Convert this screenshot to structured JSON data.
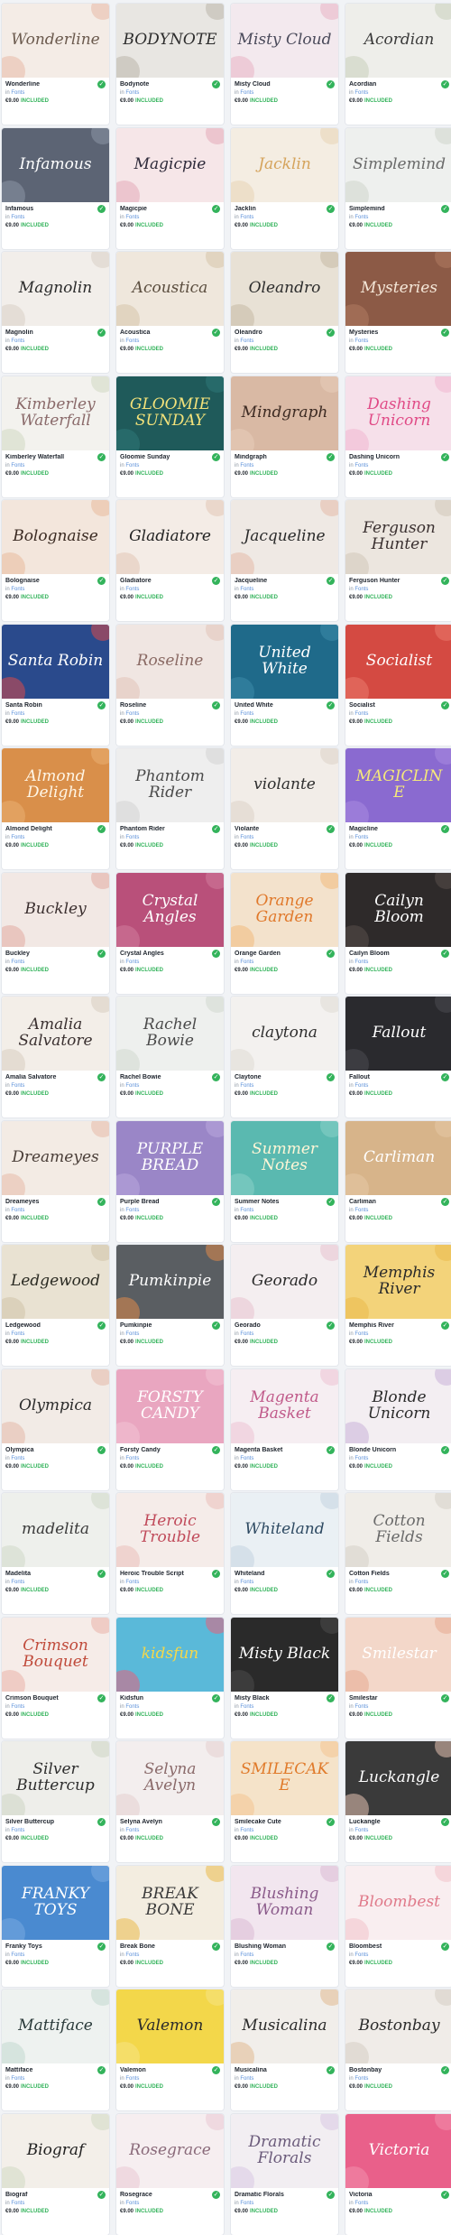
{
  "labels": {
    "by": "in",
    "category": "Fonts",
    "included": "INCLUDED"
  },
  "colors": {
    "check": "#33b35b",
    "category": "#5a8fd9"
  },
  "items": [
    {
      "name": "Wonderline",
      "title": "Wonderline",
      "price": "€9.00",
      "bg": "#f4ece6",
      "fg": "#6b5a4e",
      "acc": "#e8b9a6"
    },
    {
      "name": "Bodynote",
      "title": "BODYNOTE",
      "price": "€9.00",
      "bg": "#e8e6e2",
      "fg": "#2c2c2c",
      "acc": "#b9b4aa"
    },
    {
      "name": "Misty Cloud",
      "title": "Misty Cloud",
      "price": "€9.00",
      "bg": "#f3e9ee",
      "fg": "#4a4a5a",
      "acc": "#e7b3c5"
    },
    {
      "name": "Acordian",
      "title": "Acordian",
      "price": "€9.00",
      "bg": "#eeeeea",
      "fg": "#3b3b3b",
      "acc": "#c9d0b9"
    },
    {
      "name": "Infamous",
      "title": "Infamous",
      "price": "€9.00",
      "bg": "#5c6474",
      "fg": "#ffffff",
      "acc": "#8d95a5"
    },
    {
      "name": "Magicpie",
      "title": "Magicpie",
      "price": "€9.00",
      "bg": "#f6e6e8",
      "fg": "#2e2a3a",
      "acc": "#e3a9b8"
    },
    {
      "name": "Jacklin",
      "title": "Jacklin",
      "price": "€9.00",
      "bg": "#f4ede2",
      "fg": "#d5a35b",
      "acc": "#e7d3b5"
    },
    {
      "name": "Simplemind",
      "title": "Simplemind",
      "price": "€9.00",
      "bg": "#eef0ee",
      "fg": "#6a6a6a",
      "acc": "#cfd6cc"
    },
    {
      "name": "Magnolin",
      "title": "Magnolin",
      "price": "€9.00",
      "bg": "#f2eeea",
      "fg": "#2a2a2a",
      "acc": "#d8cfc4"
    },
    {
      "name": "Acoustica",
      "title": "Acoustica",
      "price": "€9.00",
      "bg": "#efe7dc",
      "fg": "#5a4d3e",
      "acc": "#d6c4aa"
    },
    {
      "name": "Oleandro",
      "title": "Oleandro",
      "price": "€9.00",
      "bg": "#e8e1d5",
      "fg": "#2c2c2c",
      "acc": "#c5b9a4"
    },
    {
      "name": "Mysteries",
      "title": "Mysteries",
      "price": "€9.00",
      "bg": "#8c5a46",
      "fg": "#f5e7d8",
      "acc": "#b07c63"
    },
    {
      "name": "Kimberley Waterfall",
      "title": "Kimberley Waterfall",
      "price": "€9.00",
      "bg": "#f3f2ee",
      "fg": "#8a6a6a",
      "acc": "#cfd9c3"
    },
    {
      "name": "Gloomie Sunday",
      "title": "GLOOMIE SUNDAY",
      "price": "€9.00",
      "bg": "#1f5a5a",
      "fg": "#f3e27a",
      "acc": "#2e7878"
    },
    {
      "name": "Mindgraph",
      "title": "Mindgraph",
      "price": "€9.00",
      "bg": "#d9b9a4",
      "fg": "#3c2a22",
      "acc": "#e8cdb9"
    },
    {
      "name": "Dashing Unicorn",
      "title": "Dashing Unicorn",
      "price": "€9.00",
      "bg": "#f6e0ea",
      "fg": "#e04a86",
      "acc": "#f1b6cf"
    },
    {
      "name": "Bolognaise",
      "title": "Bolognaise",
      "price": "€9.00",
      "bg": "#f3e6dc",
      "fg": "#3a2a22",
      "acc": "#e7b99c"
    },
    {
      "name": "Gladiatore",
      "title": "Gladiatore",
      "price": "€9.00",
      "bg": "#f4ece6",
      "fg": "#222222",
      "acc": "#e2c7b4"
    },
    {
      "name": "Jacqueline",
      "title": "Jacqueline",
      "price": "€9.00",
      "bg": "#efe9e4",
      "fg": "#2a2a2a",
      "acc": "#e3b9a8"
    },
    {
      "name": "Ferguson Hunter",
      "title": "Ferguson Hunter",
      "price": "€9.00",
      "bg": "#ece6df",
      "fg": "#3a3030",
      "acc": "#d2c6b8"
    },
    {
      "name": "Santa Robin",
      "title": "Santa Robin",
      "price": "€9.00",
      "bg": "#2a4a8c",
      "fg": "#ffffff",
      "acc": "#d94a4a"
    },
    {
      "name": "Roseline",
      "title": "Roseline",
      "price": "€9.00",
      "bg": "#f0e6e2",
      "fg": "#8a6a64",
      "acc": "#e1c2b8"
    },
    {
      "name": "United White",
      "title": "United White",
      "price": "€9.00",
      "bg": "#1f6a8a",
      "fg": "#ffffff",
      "acc": "#3c8aa9"
    },
    {
      "name": "Socialist",
      "title": "Socialist",
      "price": "€9.00",
      "bg": "#d44a42",
      "fg": "#ffffff",
      "acc": "#e97a6e"
    },
    {
      "name": "Almond Delight",
      "title": "Almond Delight",
      "price": "€9.00",
      "bg": "#d98f4a",
      "fg": "#fff6e6",
      "acc": "#e9b073"
    },
    {
      "name": "Phantom Rider",
      "title": "Phantom Rider",
      "price": "€9.00",
      "bg": "#eeeeee",
      "fg": "#4a4a4a",
      "acc": "#d3d3d3"
    },
    {
      "name": "Violante",
      "title": "violante",
      "price": "€9.00",
      "bg": "#f2ede8",
      "fg": "#2e2e2e",
      "acc": "#dcd2c6"
    },
    {
      "name": "Magicline",
      "title": "MAGICLINE",
      "price": "€9.00",
      "bg": "#8a6ad0",
      "fg": "#f5e97a",
      "acc": "#a98ae0"
    },
    {
      "name": "Buckley",
      "title": "Buckley",
      "price": "€9.00",
      "bg": "#f2e8e4",
      "fg": "#3a2e2e",
      "acc": "#e1a9a0"
    },
    {
      "name": "Crystal Angles",
      "title": "Crystal Angles",
      "price": "€9.00",
      "bg": "#b9507a",
      "fg": "#ffffff",
      "acc": "#d27b9c"
    },
    {
      "name": "Orange Garden",
      "title": "Orange Garden",
      "price": "€9.00",
      "bg": "#f3e2cc",
      "fg": "#e0782a",
      "acc": "#f0b97c"
    },
    {
      "name": "Cailyn Bloom",
      "title": "Cailyn Bloom",
      "price": "€9.00",
      "bg": "#2e2a2a",
      "fg": "#ffffff",
      "acc": "#5a4e4a"
    },
    {
      "name": "Amalia Salvatore",
      "title": "Amalia Salvatore",
      "price": "€9.00",
      "bg": "#f3eee8",
      "fg": "#3a3030",
      "acc": "#d7cdbf"
    },
    {
      "name": "Rachel Bowie",
      "title": "Rachel Bowie",
      "price": "€9.00",
      "bg": "#eef0ee",
      "fg": "#4a4a4a",
      "acc": "#d1d9cf"
    },
    {
      "name": "Claytone",
      "title": "claytona",
      "price": "€9.00",
      "bg": "#f3f1ef",
      "fg": "#2e2e2e",
      "acc": "#dedad4"
    },
    {
      "name": "Fallout",
      "title": "Fallout",
      "price": "€9.00",
      "bg": "#2a2a2e",
      "fg": "#ffffff",
      "acc": "#4a4a52"
    },
    {
      "name": "Dreameyes",
      "title": "Dreameyes",
      "price": "€9.00",
      "bg": "#f3ebe4",
      "fg": "#4a3e38",
      "acc": "#e6b9a8"
    },
    {
      "name": "Purple Bread",
      "title": "PURPLE BREAD",
      "price": "€9.00",
      "bg": "#9a86c7",
      "fg": "#ffffff",
      "acc": "#b9a8dc"
    },
    {
      "name": "Summer Notes",
      "title": "Summer Notes",
      "price": "€9.00",
      "bg": "#5ab9b0",
      "fg": "#fff6d6",
      "acc": "#8ad2c9"
    },
    {
      "name": "Carliman",
      "title": "Carliman",
      "price": "€9.00",
      "bg": "#d7b48a",
      "fg": "#ffffff",
      "acc": "#e6c9a6"
    },
    {
      "name": "Ledgewood",
      "title": "Ledgewood",
      "price": "€9.00",
      "bg": "#e9e2d2",
      "fg": "#2a2a22",
      "acc": "#cfc3a8"
    },
    {
      "name": "Pumkinpie",
      "title": "Pumkinpie",
      "price": "€9.00",
      "bg": "#5a5e62",
      "fg": "#ffffff",
      "acc": "#e08a4a"
    },
    {
      "name": "Georado",
      "title": "Georado",
      "price": "€9.00",
      "bg": "#f4eef0",
      "fg": "#2a2a2a",
      "acc": "#e7c3d0"
    },
    {
      "name": "Memphis River",
      "title": "Memphis River",
      "price": "€9.00",
      "bg": "#f3d37a",
      "fg": "#2a2a2a",
      "acc": "#e9b94a"
    },
    {
      "name": "Olympica",
      "title": "Olympica",
      "price": "€9.00",
      "bg": "#f2ebe6",
      "fg": "#2a2a2a",
      "acc": "#e4b8a8"
    },
    {
      "name": "Forsty Candy",
      "title": "FORSTY CANDY",
      "price": "€9.00",
      "bg": "#e9a6c0",
      "fg": "#ffffff",
      "acc": "#f2c3d4"
    },
    {
      "name": "Magenta Basket",
      "title": "Magenta Basket",
      "price": "€9.00",
      "bg": "#f6eef2",
      "fg": "#c05a8a",
      "acc": "#ecc3d4"
    },
    {
      "name": "Blonde Unicorn",
      "title": "Blonde Unicorn",
      "price": "€9.00",
      "bg": "#f3eef2",
      "fg": "#2a2a2a",
      "acc": "#c9b3d9"
    },
    {
      "name": "Madelita",
      "title": "madelita",
      "price": "€9.00",
      "bg": "#eef0ec",
      "fg": "#3a3a3a",
      "acc": "#cfd9c9"
    },
    {
      "name": "Heroic Trouble Script",
      "title": "Heroic Trouble",
      "price": "€9.00",
      "bg": "#f5ece9",
      "fg": "#c04a5a",
      "acc": "#e9c0b9"
    },
    {
      "name": "Whiteland",
      "title": "Whiteland",
      "price": "€9.00",
      "bg": "#eaf0f4",
      "fg": "#2e4a62",
      "acc": "#c3d4e0"
    },
    {
      "name": "Cotton Fields",
      "title": "Cotton Fields",
      "price": "€9.00",
      "bg": "#f0ede8",
      "fg": "#6a6a6a",
      "acc": "#d6d0c6"
    },
    {
      "name": "Crimson Bouquet",
      "title": "Crimson Bouquet",
      "price": "€9.00",
      "bg": "#f6ece8",
      "fg": "#c04a3a",
      "acc": "#e9b3a8"
    },
    {
      "name": "Kidsfun",
      "title": "kidsfun",
      "price": "€9.00",
      "bg": "#5ab9d9",
      "fg": "#f5d84a",
      "acc": "#e9607a"
    },
    {
      "name": "Misty Black",
      "title": "Misty Black",
      "price": "€9.00",
      "bg": "#2a2a2a",
      "fg": "#ffffff",
      "acc": "#4a4a4a"
    },
    {
      "name": "Smilestar",
      "title": "Smilestar",
      "price": "€9.00",
      "bg": "#f3d7c9",
      "fg": "#ffffff",
      "acc": "#e6a98f"
    },
    {
      "name": "Silver Buttercup",
      "title": "Silver Buttercup",
      "price": "€9.00",
      "bg": "#eeeeea",
      "fg": "#2e2e2e",
      "acc": "#cdd6c3"
    },
    {
      "name": "Selyna Avelyn",
      "title": "Selyna Avelyn",
      "price": "€9.00",
      "bg": "#f3eeee",
      "fg": "#8a6a6a",
      "acc": "#e3cfcf"
    },
    {
      "name": "Smilecake Cute",
      "title": "SMILECAKE",
      "price": "€9.00",
      "bg": "#f5e3c9",
      "fg": "#e07a2a",
      "acc": "#f2c58f"
    },
    {
      "name": "Luckangle",
      "title": "Luckangle",
      "price": "€9.00",
      "bg": "#3a3a3a",
      "fg": "#ffffff",
      "acc": "#e6c3b3"
    },
    {
      "name": "Franky Toys",
      "title": "FRANKY TOYS",
      "price": "€9.00",
      "bg": "#4a8ad0",
      "fg": "#ffffff",
      "acc": "#79a9e0"
    },
    {
      "name": "Break Bone",
      "title": "BREAK BONE",
      "price": "€9.00",
      "bg": "#f3ede0",
      "fg": "#3a3a3a",
      "acc": "#e9b94a"
    },
    {
      "name": "Blushing Woman",
      "title": "Blushing Woman",
      "price": "€9.00",
      "bg": "#f2e6ef",
      "fg": "#8a5a8a",
      "acc": "#dbb9d4"
    },
    {
      "name": "Bloombest",
      "title": "Bloombest",
      "price": "€9.00",
      "bg": "#f9eef0",
      "fg": "#e07a8a",
      "acc": "#f2c3cb"
    },
    {
      "name": "Mattiface",
      "title": "Mattiface",
      "price": "€9.00",
      "bg": "#eef2f0",
      "fg": "#2a3a3a",
      "acc": "#c3d9d0"
    },
    {
      "name": "Valemon",
      "title": "Valemon",
      "price": "€9.00",
      "bg": "#f3d74a",
      "fg": "#2a2a2a",
      "acc": "#f6e383"
    },
    {
      "name": "Musicalina",
      "title": "Musicalina",
      "price": "€9.00",
      "bg": "#f1eeea",
      "fg": "#2a2a2a",
      "acc": "#e0b98f"
    },
    {
      "name": "Bostonbay",
      "title": "Bostonbay",
      "price": "€9.00",
      "bg": "#f0ece8",
      "fg": "#2a2a2a",
      "acc": "#d6cdc3"
    },
    {
      "name": "Biograf",
      "title": "Biograf",
      "price": "€9.00",
      "bg": "#f3efe9",
      "fg": "#1f1f1f",
      "acc": "#cfd9c3"
    },
    {
      "name": "Rosegrace",
      "title": "Rosegrace",
      "price": "€9.00",
      "bg": "#f6eef0",
      "fg": "#8a6a7a",
      "acc": "#e9c9d3"
    },
    {
      "name": "Dramatic Florals",
      "title": "Dramatic Florals",
      "price": "€9.00",
      "bg": "#f2eef2",
      "fg": "#6a5a7a",
      "acc": "#d9c9e3"
    },
    {
      "name": "Victoria",
      "title": "Victoria",
      "price": "€9.00",
      "bg": "#e9608a",
      "fg": "#ffffff",
      "acc": "#f290ad"
    }
  ]
}
